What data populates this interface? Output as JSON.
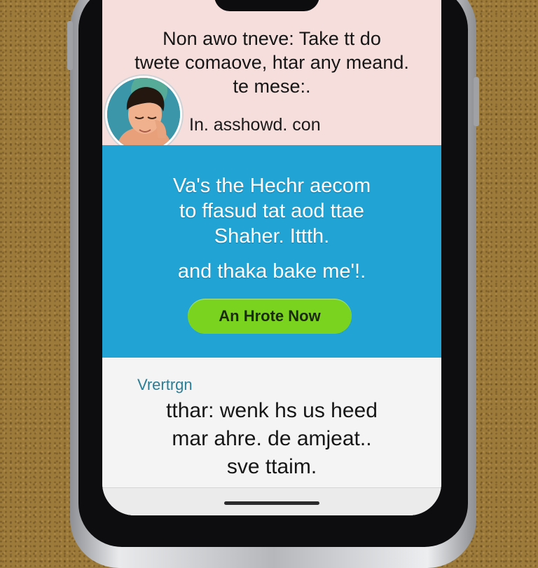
{
  "header": {
    "headline_lines": [
      "Non awo tneve: Take tt do",
      "twete comaove, htar any meand.",
      "te mese:."
    ],
    "avatar_icon": "user-avatar",
    "handle": "In. asshowd. con"
  },
  "promo": {
    "lines": [
      "Va's the Hechr aecom",
      "to ffasud tat aod ttae",
      "Shaher. Ittth.",
      "and thaka bake me'!."
    ],
    "cta_label": "An Hrote Now",
    "background": "#21a3d4",
    "cta_color": "#7ad41f"
  },
  "footer": {
    "label": "Vrertrgn",
    "text_lines": [
      "tthar: wenk hs us heed",
      "mar ahre. de amjeat..",
      "sve ttaim."
    ]
  }
}
